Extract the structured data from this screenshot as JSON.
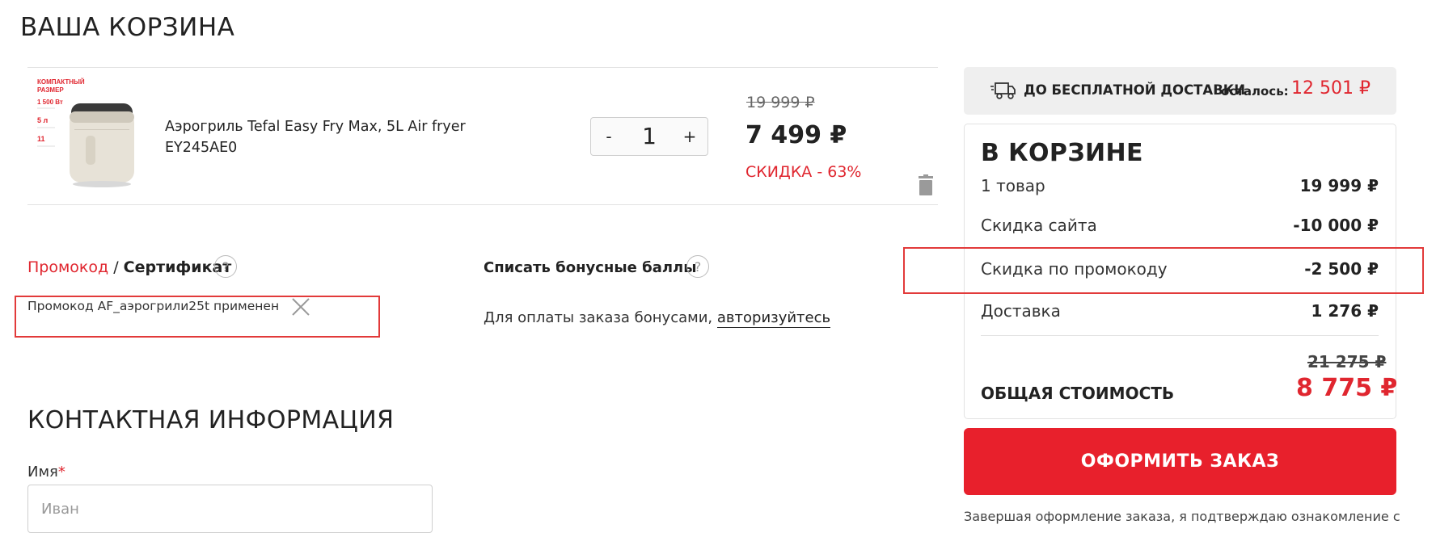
{
  "page": {
    "title": "ВАША КОРЗИНА"
  },
  "product": {
    "image_label_lines": [
      "КОМПАКТНЫЙ",
      "РАЗМЕР",
      "1 500 Вт",
      "5 л",
      "11"
    ],
    "name": "Аэрогриль Tefal Easy Fry Max, 5L Air fryer EY245AE0",
    "quantity": "1",
    "minus_label": "-",
    "plus_label": "+",
    "old_price": "19 999 ₽",
    "price": "7 499 ₽",
    "discount": "СКИДКА - 63%"
  },
  "promo": {
    "tab_promo": "Промокод",
    "separator": " / ",
    "tab_certificate": "Сертификат",
    "help_icon": "?",
    "applied_text": "Промокод AF_аэрогрили25t применен"
  },
  "bonus": {
    "title": "Списать бонусные баллы",
    "help_icon": "?",
    "text": "Для оплаты заказа бонусами, ",
    "link": "авторизуйтесь"
  },
  "contact": {
    "title": "КОНТАКТНАЯ ИНФОРМАЦИЯ",
    "name_label": "Имя",
    "name_required": "*",
    "name_placeholder": "Иван"
  },
  "delivery": {
    "text": "ДО БЕСПЛАТНОЙ ДОСТАВКИ",
    "left_label": "осталось:",
    "amount": "12 501 ₽"
  },
  "summary": {
    "title": "В КОРЗИНЕ",
    "rows": [
      {
        "label": "1 товар",
        "value": "19 999 ₽"
      },
      {
        "label": "Скидка сайта",
        "value": "-10 000 ₽"
      },
      {
        "label": "Скидка по промокоду",
        "value": "-2 500 ₽"
      },
      {
        "label": "Доставка",
        "value": "1 276 ₽"
      }
    ],
    "total_old": "21 275 ₽",
    "total_label": "ОБЩАЯ СТОИМОСТЬ",
    "total_new": "8 775 ₽"
  },
  "checkout": {
    "label": "ОФОРМИТЬ ЗАКАЗ"
  },
  "consent": {
    "text": "Завершая оформление заказа, я подтверждаю ознакомление с"
  },
  "colors": {
    "accent": "#e0262f",
    "button": "#e8202c",
    "highlight": "#e23a3a"
  },
  "icons": [
    "truck-icon",
    "trash-icon",
    "close-icon",
    "help-icon"
  ]
}
